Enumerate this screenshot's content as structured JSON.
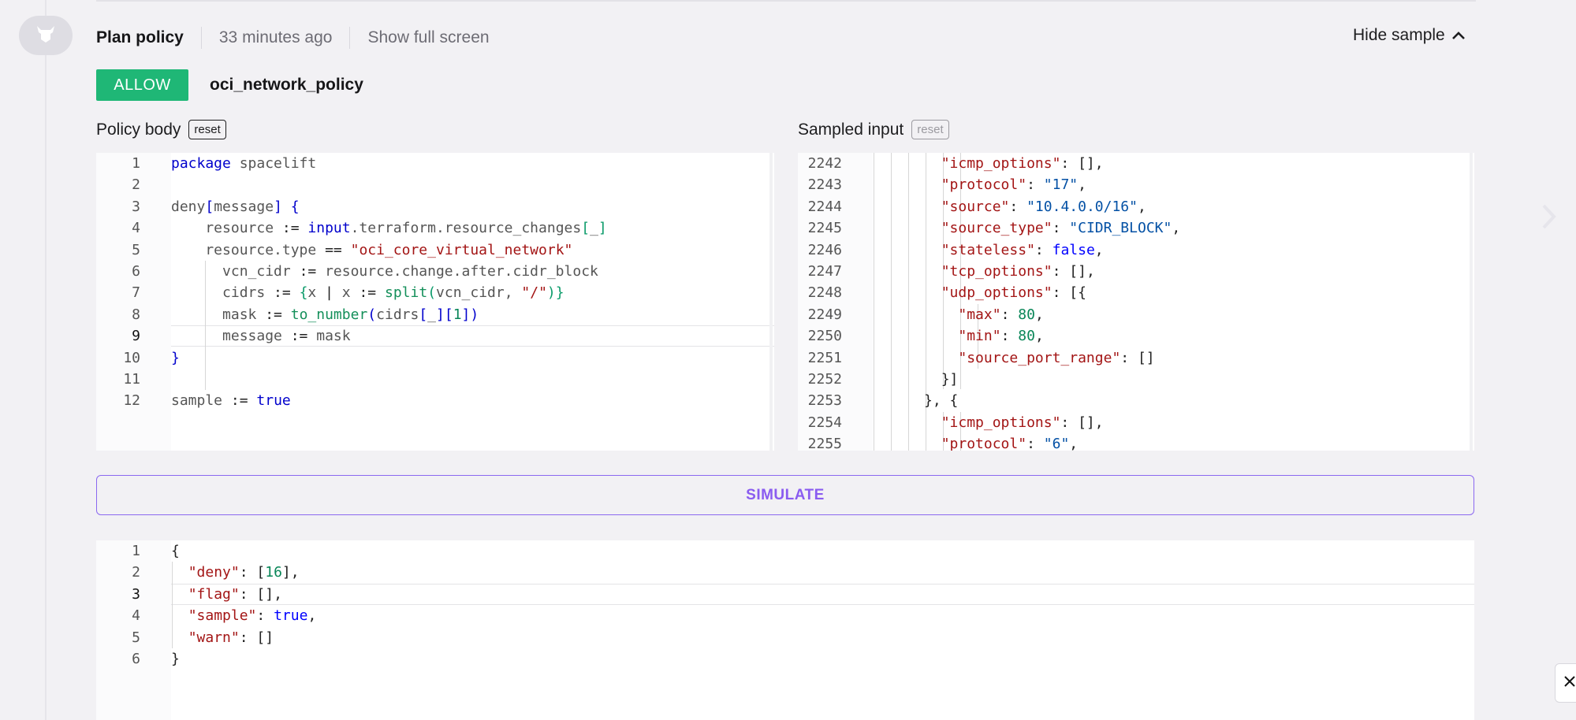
{
  "header": {
    "title": "Plan policy",
    "time": "33 minutes ago",
    "fullscreen_link": "Show full screen",
    "hide_sample": "Hide sample"
  },
  "policy": {
    "badge": "ALLOW",
    "name": "oci_network_policy"
  },
  "policy_body": {
    "label": "Policy body",
    "reset_label": "reset"
  },
  "sampled_input": {
    "label": "Sampled input",
    "reset_label": "reset"
  },
  "simulate_label": "SIMULATE",
  "policy_code": {
    "line_numbers": [
      "1",
      "2",
      "3",
      "4",
      "5",
      "6",
      "7",
      "8",
      "9",
      "10",
      "11",
      "12"
    ],
    "active_line": 9,
    "lines": [
      [
        {
          "t": "package",
          "c": "kw"
        },
        {
          "t": " spacelift",
          "c": "id"
        }
      ],
      [],
      [
        {
          "t": "deny",
          "c": "id"
        },
        {
          "t": "[",
          "c": "kw"
        },
        {
          "t": "message",
          "c": "id"
        },
        {
          "t": "]",
          "c": "kw"
        },
        {
          "t": " {",
          "c": "kw"
        }
      ],
      [
        {
          "t": "    resource ",
          "c": "id"
        },
        {
          "t": ":=",
          "c": "op"
        },
        {
          "t": " ",
          "c": "id"
        },
        {
          "t": "input",
          "c": "kw"
        },
        {
          "t": ".terraform.resource_changes",
          "c": "id"
        },
        {
          "t": "[",
          "c": "brk"
        },
        {
          "t": "_",
          "c": "id"
        },
        {
          "t": "]",
          "c": "brk"
        }
      ],
      [
        {
          "t": "    resource.type ",
          "c": "id"
        },
        {
          "t": "==",
          "c": "op"
        },
        {
          "t": " ",
          "c": "id"
        },
        {
          "t": "\"oci_core_virtual_network\"",
          "c": "str"
        }
      ],
      [
        {
          "t": "      vcn_cidr ",
          "c": "id"
        },
        {
          "t": ":=",
          "c": "op"
        },
        {
          "t": " resource.change.after.cidr_block",
          "c": "id"
        }
      ],
      [
        {
          "t": "      cidrs ",
          "c": "id"
        },
        {
          "t": ":=",
          "c": "op"
        },
        {
          "t": " ",
          "c": "id"
        },
        {
          "t": "{",
          "c": "brk"
        },
        {
          "t": "x ",
          "c": "id"
        },
        {
          "t": "|",
          "c": "op"
        },
        {
          "t": " x ",
          "c": "id"
        },
        {
          "t": ":=",
          "c": "op"
        },
        {
          "t": " ",
          "c": "id"
        },
        {
          "t": "split",
          "c": "fn"
        },
        {
          "t": "(",
          "c": "brk"
        },
        {
          "t": "vcn_cidr, ",
          "c": "id"
        },
        {
          "t": "\"/\"",
          "c": "str"
        },
        {
          "t": ")}",
          "c": "brk"
        }
      ],
      [
        {
          "t": "      mask ",
          "c": "id"
        },
        {
          "t": ":=",
          "c": "op"
        },
        {
          "t": " ",
          "c": "id"
        },
        {
          "t": "to_number",
          "c": "fn"
        },
        {
          "t": "(",
          "c": "kw"
        },
        {
          "t": "cidrs",
          "c": "id"
        },
        {
          "t": "[",
          "c": "kw"
        },
        {
          "t": "_",
          "c": "id"
        },
        {
          "t": "][",
          "c": "kw"
        },
        {
          "t": "1",
          "c": "num"
        },
        {
          "t": "])",
          "c": "kw"
        }
      ],
      [
        {
          "t": "      message ",
          "c": "id"
        },
        {
          "t": ":=",
          "c": "op"
        },
        {
          "t": " mask",
          "c": "id"
        }
      ],
      [
        {
          "t": "}",
          "c": "kw"
        }
      ],
      [],
      [
        {
          "t": "sample ",
          "c": "id"
        },
        {
          "t": ":=",
          "c": "op"
        },
        {
          "t": " ",
          "c": "id"
        },
        {
          "t": "true",
          "c": "bool"
        }
      ]
    ]
  },
  "sample_code": {
    "line_numbers": [
      "2242",
      "2243",
      "2244",
      "2245",
      "2246",
      "2247",
      "2248",
      "2249",
      "2250",
      "2251",
      "2252",
      "2253",
      "2254",
      "2255"
    ],
    "lines": [
      [
        {
          "t": "        ",
          "c": "punct"
        },
        {
          "t": "\"icmp_options\"",
          "c": "key"
        },
        {
          "t": ": [],",
          "c": "punct"
        }
      ],
      [
        {
          "t": "        ",
          "c": "punct"
        },
        {
          "t": "\"protocol\"",
          "c": "key"
        },
        {
          "t": ": ",
          "c": "punct"
        },
        {
          "t": "\"17\"",
          "c": "sval"
        },
        {
          "t": ",",
          "c": "punct"
        }
      ],
      [
        {
          "t": "        ",
          "c": "punct"
        },
        {
          "t": "\"source\"",
          "c": "key"
        },
        {
          "t": ": ",
          "c": "punct"
        },
        {
          "t": "\"10.4.0.0/16\"",
          "c": "sval"
        },
        {
          "t": ",",
          "c": "punct"
        }
      ],
      [
        {
          "t": "        ",
          "c": "punct"
        },
        {
          "t": "\"source_type\"",
          "c": "key"
        },
        {
          "t": ": ",
          "c": "punct"
        },
        {
          "t": "\"CIDR_BLOCK\"",
          "c": "sval"
        },
        {
          "t": ",",
          "c": "punct"
        }
      ],
      [
        {
          "t": "        ",
          "c": "punct"
        },
        {
          "t": "\"stateless\"",
          "c": "key"
        },
        {
          "t": ": ",
          "c": "punct"
        },
        {
          "t": "false",
          "c": "bval"
        },
        {
          "t": ",",
          "c": "punct"
        }
      ],
      [
        {
          "t": "        ",
          "c": "punct"
        },
        {
          "t": "\"tcp_options\"",
          "c": "key"
        },
        {
          "t": ": [],",
          "c": "punct"
        }
      ],
      [
        {
          "t": "        ",
          "c": "punct"
        },
        {
          "t": "\"udp_options\"",
          "c": "key"
        },
        {
          "t": ": [{",
          "c": "punct"
        }
      ],
      [
        {
          "t": "          ",
          "c": "punct"
        },
        {
          "t": "\"max\"",
          "c": "key"
        },
        {
          "t": ": ",
          "c": "punct"
        },
        {
          "t": "80",
          "c": "nval"
        },
        {
          "t": ",",
          "c": "punct"
        }
      ],
      [
        {
          "t": "          ",
          "c": "punct"
        },
        {
          "t": "\"min\"",
          "c": "key"
        },
        {
          "t": ": ",
          "c": "punct"
        },
        {
          "t": "80",
          "c": "nval"
        },
        {
          "t": ",",
          "c": "punct"
        }
      ],
      [
        {
          "t": "          ",
          "c": "punct"
        },
        {
          "t": "\"source_port_range\"",
          "c": "key"
        },
        {
          "t": ": []",
          "c": "punct"
        }
      ],
      [
        {
          "t": "        }]",
          "c": "punct"
        }
      ],
      [
        {
          "t": "      }, {",
          "c": "punct"
        }
      ],
      [
        {
          "t": "        ",
          "c": "punct"
        },
        {
          "t": "\"icmp_options\"",
          "c": "key"
        },
        {
          "t": ": [],",
          "c": "punct"
        }
      ],
      [
        {
          "t": "        ",
          "c": "punct"
        },
        {
          "t": "\"protocol\"",
          "c": "key"
        },
        {
          "t": ": ",
          "c": "punct"
        },
        {
          "t": "\"6\"",
          "c": "sval"
        },
        {
          "t": ",",
          "c": "punct"
        }
      ]
    ]
  },
  "output_code": {
    "line_numbers": [
      "1",
      "2",
      "3",
      "4",
      "5",
      "6"
    ],
    "active_line": 3,
    "lines": [
      [
        {
          "t": "{",
          "c": "punct"
        }
      ],
      [
        {
          "t": "  ",
          "c": "punct"
        },
        {
          "t": "\"deny\"",
          "c": "key"
        },
        {
          "t": ": [",
          "c": "punct"
        },
        {
          "t": "16",
          "c": "nval"
        },
        {
          "t": "],",
          "c": "punct"
        }
      ],
      [
        {
          "t": "  ",
          "c": "punct"
        },
        {
          "t": "\"flag\"",
          "c": "key"
        },
        {
          "t": ": [],",
          "c": "punct"
        }
      ],
      [
        {
          "t": "  ",
          "c": "punct"
        },
        {
          "t": "\"sample\"",
          "c": "key"
        },
        {
          "t": ": ",
          "c": "punct"
        },
        {
          "t": "true",
          "c": "bval"
        },
        {
          "t": ",",
          "c": "punct"
        }
      ],
      [
        {
          "t": "  ",
          "c": "punct"
        },
        {
          "t": "\"warn\"",
          "c": "key"
        },
        {
          "t": ": []",
          "c": "punct"
        }
      ],
      [
        {
          "t": "}",
          "c": "punct"
        }
      ]
    ]
  },
  "icons": {
    "avatar": "bull-logo-icon",
    "hide_sample": "chevron-up-icon",
    "next": "chevron-right-icon",
    "close": "close-icon"
  }
}
